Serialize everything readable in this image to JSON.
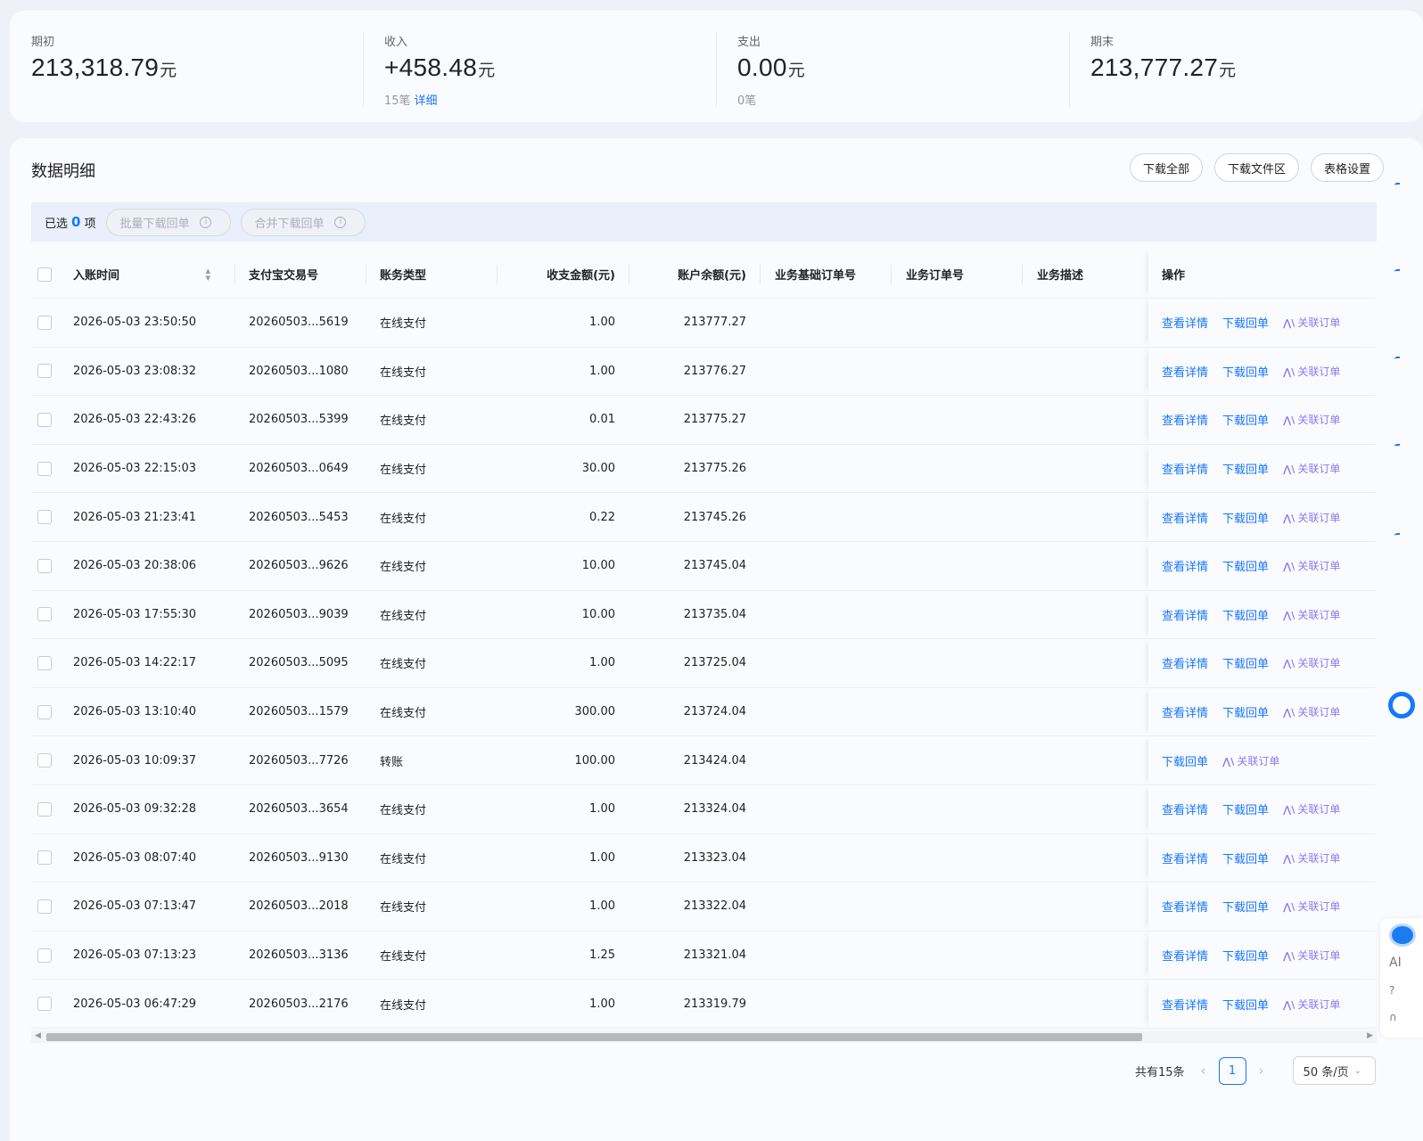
{
  "summary": [
    {
      "label": "期初",
      "value": "213,318.79",
      "unit": "元",
      "sub_count": "",
      "sub_link": ""
    },
    {
      "label": "收入",
      "value": "+458.48",
      "unit": "元",
      "sub_count": "15笔",
      "sub_link": "详细"
    },
    {
      "label": "支出",
      "value": "0.00",
      "unit": "元",
      "sub_count": "0笔",
      "sub_link": ""
    },
    {
      "label": "期末",
      "value": "213,777.27",
      "unit": "元",
      "sub_count": "",
      "sub_link": ""
    }
  ],
  "panel": {
    "title": "数据明细",
    "buttons": [
      "下载全部",
      "下载文件区",
      "表格设置"
    ]
  },
  "selection": {
    "prefix": "已选",
    "count": "0",
    "suffix": "项",
    "batch_download": "批量下载回单",
    "merge_download": "合并下载回单"
  },
  "table": {
    "columns": [
      "入账时间",
      "支付宝交易号",
      "账务类型",
      "收支金额(元)",
      "账户余额(元)",
      "业务基础订单号",
      "业务订单号",
      "业务描述",
      "操作"
    ],
    "actions": {
      "detail": "查看详情",
      "download": "下载回单",
      "relate": "关联订单"
    },
    "rows": [
      {
        "time": "2026-05-03 23:50:50",
        "trade": "20260503...5619",
        "type": "在线支付",
        "amount": "1.00",
        "balance": "213777.27",
        "detail": true
      },
      {
        "time": "2026-05-03 23:08:32",
        "trade": "20260503...1080",
        "type": "在线支付",
        "amount": "1.00",
        "balance": "213776.27",
        "detail": true
      },
      {
        "time": "2026-05-03 22:43:26",
        "trade": "20260503...5399",
        "type": "在线支付",
        "amount": "0.01",
        "balance": "213775.27",
        "detail": true
      },
      {
        "time": "2026-05-03 22:15:03",
        "trade": "20260503...0649",
        "type": "在线支付",
        "amount": "30.00",
        "balance": "213775.26",
        "detail": true
      },
      {
        "time": "2026-05-03 21:23:41",
        "trade": "20260503...5453",
        "type": "在线支付",
        "amount": "0.22",
        "balance": "213745.26",
        "detail": true
      },
      {
        "time": "2026-05-03 20:38:06",
        "trade": "20260503...9626",
        "type": "在线支付",
        "amount": "10.00",
        "balance": "213745.04",
        "detail": true
      },
      {
        "time": "2026-05-03 17:55:30",
        "trade": "20260503...9039",
        "type": "在线支付",
        "amount": "10.00",
        "balance": "213735.04",
        "detail": true
      },
      {
        "time": "2026-05-03 14:22:17",
        "trade": "20260503...5095",
        "type": "在线支付",
        "amount": "1.00",
        "balance": "213725.04",
        "detail": true
      },
      {
        "time": "2026-05-03 13:10:40",
        "trade": "20260503...1579",
        "type": "在线支付",
        "amount": "300.00",
        "balance": "213724.04",
        "detail": true
      },
      {
        "time": "2026-05-03 10:09:37",
        "trade": "20260503...7726",
        "type": "转账",
        "amount": "100.00",
        "balance": "213424.04",
        "detail": false
      },
      {
        "time": "2026-05-03 09:32:28",
        "trade": "20260503...3654",
        "type": "在线支付",
        "amount": "1.00",
        "balance": "213324.04",
        "detail": true
      },
      {
        "time": "2026-05-03 08:07:40",
        "trade": "20260503...9130",
        "type": "在线支付",
        "amount": "1.00",
        "balance": "213323.04",
        "detail": true
      },
      {
        "time": "2026-05-03 07:13:47",
        "trade": "20260503...2018",
        "type": "在线支付",
        "amount": "1.00",
        "balance": "213322.04",
        "detail": true
      },
      {
        "time": "2026-05-03 07:13:23",
        "trade": "20260503...3136",
        "type": "在线支付",
        "amount": "1.25",
        "balance": "213321.04",
        "detail": true
      },
      {
        "time": "2026-05-03 06:47:29",
        "trade": "20260503...2176",
        "type": "在线支付",
        "amount": "1.00",
        "balance": "213319.79",
        "detail": true
      }
    ]
  },
  "pagination": {
    "total": "共有15条",
    "page": "1",
    "page_size": "50 条/页"
  },
  "floating": {
    "ai_label": "AI"
  },
  "colors": {
    "accent": "#1677ff",
    "relate": "#8b7cf0",
    "background": "#eef2f8"
  }
}
